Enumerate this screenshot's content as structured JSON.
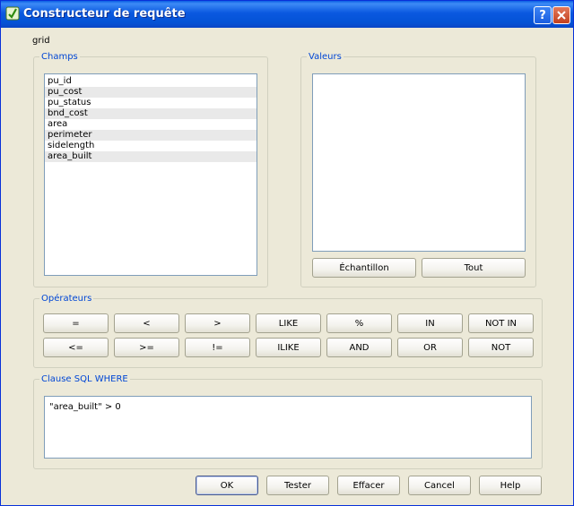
{
  "window": {
    "title": "Constructeur de requête",
    "help_icon": "question-mark-icon",
    "close_icon": "close-x-icon"
  },
  "layer_name": "grid",
  "fields": {
    "legend": "Champs",
    "items": [
      "pu_id",
      "pu_cost",
      "pu_status",
      "bnd_cost",
      "area",
      "perimeter",
      "sidelength",
      "area_built"
    ]
  },
  "values": {
    "legend": "Valeurs",
    "sample_label": "Échantillon",
    "all_label": "Tout"
  },
  "operators": {
    "legend": "Opérateurs",
    "row1": [
      "=",
      "<",
      ">",
      "LIKE",
      "%",
      "IN",
      "NOT IN"
    ],
    "row2": [
      "<=",
      ">=",
      "!=",
      "ILIKE",
      "AND",
      "OR",
      "NOT"
    ]
  },
  "sql": {
    "legend": "Clause SQL WHERE",
    "text": "\"area_built\" > 0"
  },
  "buttons": {
    "ok": "OK",
    "test": "Tester",
    "clear": "Effacer",
    "cancel": "Cancel",
    "help": "Help"
  }
}
